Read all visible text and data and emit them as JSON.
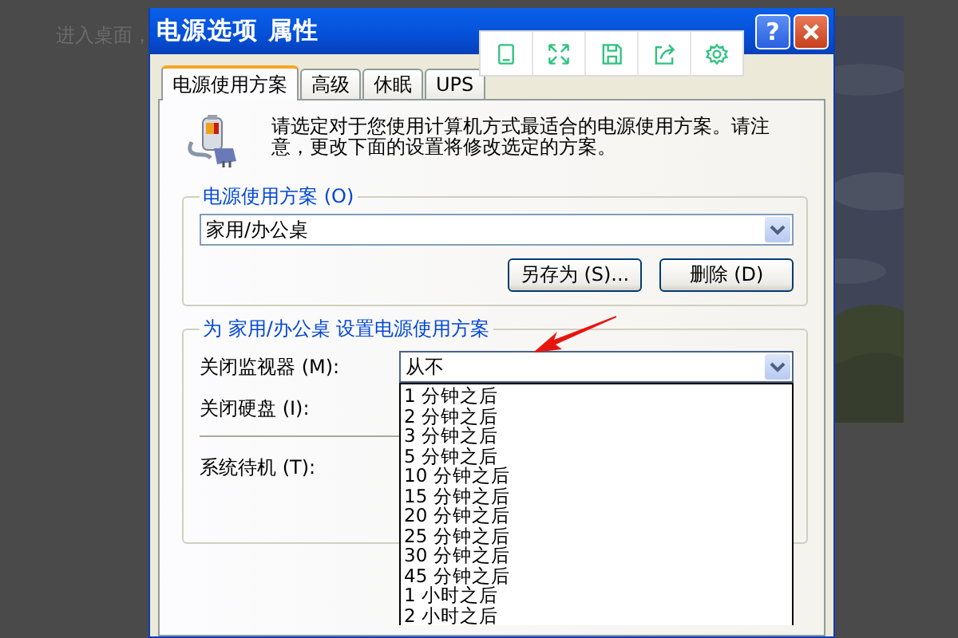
{
  "background_page": {
    "text": "进入桌面，"
  },
  "window": {
    "title": "电源选项 属性",
    "help_button": "?"
  },
  "toolbar": {
    "icons": [
      {
        "kind": "tablet"
      },
      {
        "kind": "expand"
      },
      {
        "kind": "save"
      },
      {
        "kind": "share"
      },
      {
        "kind": "settings"
      }
    ]
  },
  "tabs": [
    {
      "label": "电源使用方案",
      "selected": true
    },
    {
      "label": "高级",
      "selected": false
    },
    {
      "label": "休眠",
      "selected": false
    },
    {
      "label": "UPS",
      "selected": false
    }
  ],
  "description": "请选定对于您使用计算机方式最适合的电源使用方案。请注意，更改下面的设置将修改选定的方案。",
  "scheme_group": {
    "title": "电源使用方案 (O)",
    "value": "家用/办公桌",
    "buttons": [
      "另存为 (S)...",
      "删除 (D)"
    ]
  },
  "settings_group": {
    "title": "为 家用/办公桌 设置电源使用方案",
    "rows": [
      {
        "label": "关闭监视器 (M):",
        "value": "从不",
        "open": true
      },
      {
        "label": "关闭硬盘 (I):"
      },
      {
        "label": "系统待机 (T):"
      }
    ],
    "options": [
      "1 分钟之后",
      "2 分钟之后",
      "3 分钟之后",
      "5 分钟之后",
      "10 分钟之后",
      "15 分钟之后",
      "20 分钟之后",
      "25 分钟之后",
      "30 分钟之后",
      "45 分钟之后",
      "1 小时之后",
      "2 小时之后"
    ]
  }
}
